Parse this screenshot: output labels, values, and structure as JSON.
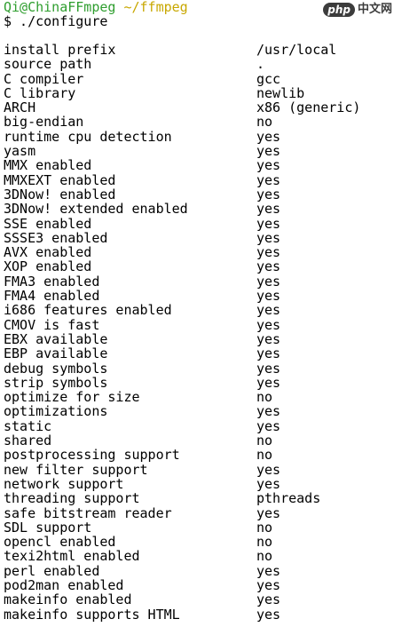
{
  "prompt": {
    "user_host": "Qi@ChinaFFmpeg",
    "path": "~/ffmpeg",
    "command": "$ ./configure"
  },
  "watermark": {
    "badge": "php",
    "text": "中文网"
  },
  "colors": {
    "user_host": "#2f9e2f",
    "path": "#c8a700"
  },
  "rows": [
    {
      "key": "install prefix",
      "value": "/usr/local"
    },
    {
      "key": "source path",
      "value": "."
    },
    {
      "key": "C compiler",
      "value": "gcc"
    },
    {
      "key": "C library",
      "value": "newlib"
    },
    {
      "key": "ARCH",
      "value": "x86 (generic)"
    },
    {
      "key": "big-endian",
      "value": "no"
    },
    {
      "key": "runtime cpu detection",
      "value": "yes"
    },
    {
      "key": "yasm",
      "value": "yes"
    },
    {
      "key": "MMX enabled",
      "value": "yes"
    },
    {
      "key": "MMXEXT enabled",
      "value": "yes"
    },
    {
      "key": "3DNow! enabled",
      "value": "yes"
    },
    {
      "key": "3DNow! extended enabled",
      "value": "yes"
    },
    {
      "key": "SSE enabled",
      "value": "yes"
    },
    {
      "key": "SSSE3 enabled",
      "value": "yes"
    },
    {
      "key": "AVX enabled",
      "value": "yes"
    },
    {
      "key": "XOP enabled",
      "value": "yes"
    },
    {
      "key": "FMA3 enabled",
      "value": "yes"
    },
    {
      "key": "FMA4 enabled",
      "value": "yes"
    },
    {
      "key": "i686 features enabled",
      "value": "yes"
    },
    {
      "key": "CMOV is fast",
      "value": "yes"
    },
    {
      "key": "EBX available",
      "value": "yes"
    },
    {
      "key": "EBP available",
      "value": "yes"
    },
    {
      "key": "debug symbols",
      "value": "yes"
    },
    {
      "key": "strip symbols",
      "value": "yes"
    },
    {
      "key": "optimize for size",
      "value": "no"
    },
    {
      "key": "optimizations",
      "value": "yes"
    },
    {
      "key": "static",
      "value": "yes"
    },
    {
      "key": "shared",
      "value": "no"
    },
    {
      "key": "postprocessing support",
      "value": "no"
    },
    {
      "key": "new filter support",
      "value": "yes"
    },
    {
      "key": "network support",
      "value": "yes"
    },
    {
      "key": "threading support",
      "value": "pthreads"
    },
    {
      "key": "safe bitstream reader",
      "value": "yes"
    },
    {
      "key": "SDL support",
      "value": "no"
    },
    {
      "key": "opencl enabled",
      "value": "no"
    },
    {
      "key": "texi2html enabled",
      "value": "no"
    },
    {
      "key": "perl enabled",
      "value": "yes"
    },
    {
      "key": "pod2man enabled",
      "value": "yes"
    },
    {
      "key": "makeinfo enabled",
      "value": "yes"
    },
    {
      "key": "makeinfo supports HTML",
      "value": "yes"
    }
  ]
}
